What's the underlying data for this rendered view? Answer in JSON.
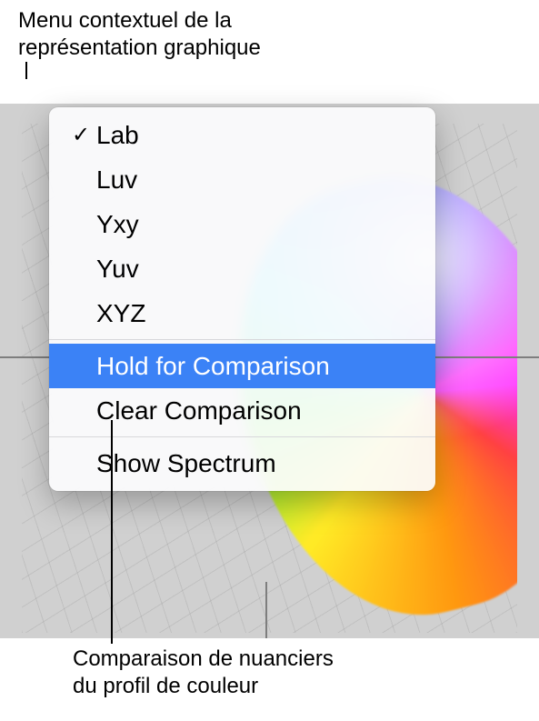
{
  "labels": {
    "top": "Menu contextuel de la\nreprésentation graphique",
    "bottom": "Comparaison de nuanciers\ndu profil de couleur"
  },
  "menu": {
    "groups": [
      {
        "items": [
          {
            "label": "Lab",
            "checked": true
          },
          {
            "label": "Luv",
            "checked": false
          },
          {
            "label": "Yxy",
            "checked": false
          },
          {
            "label": "Yuv",
            "checked": false
          },
          {
            "label": "XYZ",
            "checked": false
          }
        ]
      },
      {
        "items": [
          {
            "label": "Hold for Comparison",
            "checked": false,
            "highlighted": true
          },
          {
            "label": "Clear Comparison",
            "checked": false
          }
        ]
      },
      {
        "items": [
          {
            "label": "Show Spectrum",
            "checked": false
          }
        ]
      }
    ]
  }
}
